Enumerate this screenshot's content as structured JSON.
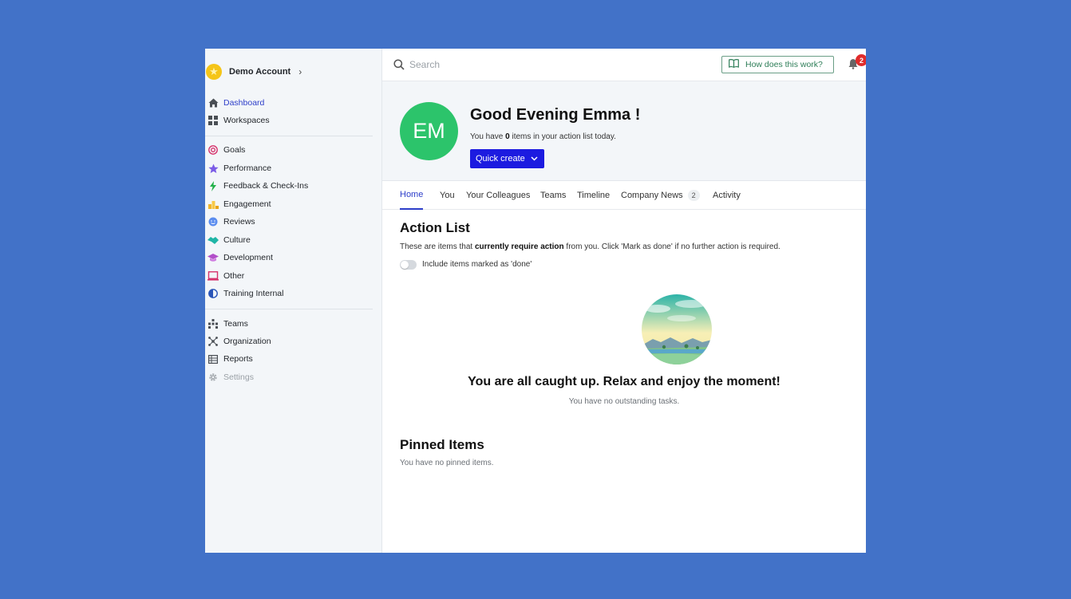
{
  "sidebar": {
    "account_name": "Demo Account",
    "items": [
      {
        "label": "Dashboard",
        "icon": "home-icon"
      },
      {
        "label": "Workspaces",
        "icon": "grid-icon"
      },
      {
        "label": "Goals",
        "icon": "target-icon"
      },
      {
        "label": "Performance",
        "icon": "star-icon"
      },
      {
        "label": "Feedback & Check-Ins",
        "icon": "lightning-icon"
      },
      {
        "label": "Engagement",
        "icon": "podium-icon"
      },
      {
        "label": "Reviews",
        "icon": "face-icon"
      },
      {
        "label": "Culture",
        "icon": "handshake-icon"
      },
      {
        "label": "Development",
        "icon": "graduation-cap-icon"
      },
      {
        "label": "Other",
        "icon": "laptop-icon"
      },
      {
        "label": "Training Internal",
        "icon": "half-circle-icon"
      },
      {
        "label": "Teams",
        "icon": "org-tree-icon"
      },
      {
        "label": "Organization",
        "icon": "network-icon"
      },
      {
        "label": "Reports",
        "icon": "table-icon"
      },
      {
        "label": "Settings",
        "icon": "gear-icon"
      }
    ]
  },
  "topbar": {
    "search_placeholder": "Search",
    "help_label": "How does this work?",
    "notification_count": "2"
  },
  "hero": {
    "initials": "EM",
    "greeting": "Good Evening Emma !",
    "sub_prefix": "You have",
    "sub_count": "0",
    "sub_suffix": "items in your action list today.",
    "quick_create": "Quick create"
  },
  "tabs": [
    {
      "label": "Home"
    },
    {
      "label": "You"
    },
    {
      "label": "Your Colleagues"
    },
    {
      "label": "Teams"
    },
    {
      "label": "Timeline"
    },
    {
      "label": "Company News",
      "count": "2"
    },
    {
      "label": "Activity"
    }
  ],
  "action_list": {
    "title": "Action List",
    "desc_prefix": "These are items that",
    "desc_bold": "currently require action",
    "desc_suffix": "from you. Click 'Mark as done' if no further action is required.",
    "toggle_label": "Include items marked as 'done'",
    "empty_title": "You are all caught up. Relax and enjoy the moment!",
    "empty_sub": "You have no outstanding tasks."
  },
  "pinned": {
    "title": "Pinned Items",
    "empty": "You have no pinned items."
  },
  "colors": {
    "background": "#4272c8",
    "accent": "#2d3ec9",
    "primary_button": "#1c1be0",
    "avatar": "#2cc46b",
    "notification": "#e02b2b"
  }
}
